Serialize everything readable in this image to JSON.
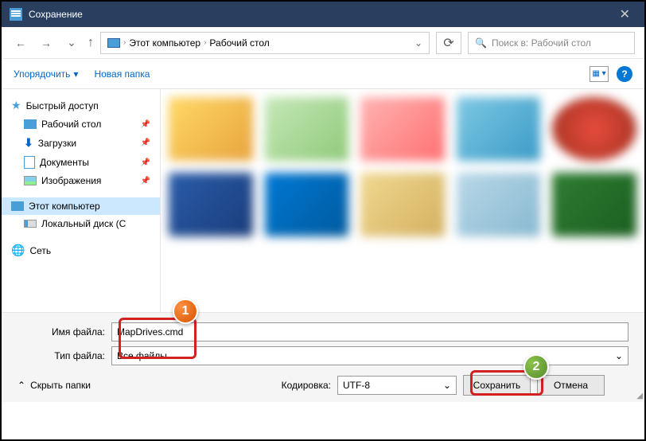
{
  "titlebar": {
    "title": "Сохранение"
  },
  "address": {
    "segments": [
      "Этот компьютер",
      "Рабочий стол"
    ]
  },
  "search": {
    "placeholder": "Поиск в: Рабочий стол"
  },
  "toolbar": {
    "organize": "Упорядочить",
    "new_folder": "Новая папка"
  },
  "sidebar": {
    "quick_access": "Быстрый доступ",
    "desktop": "Рабочий стол",
    "downloads": "Загрузки",
    "documents": "Документы",
    "pictures": "Изображения",
    "this_pc": "Этот компьютер",
    "local_disk": "Локальный диск (С",
    "network": "Сеть"
  },
  "form": {
    "filename_label": "Имя файла:",
    "filename_value": "MapDrives.cmd",
    "filetype_label": "Тип файла:",
    "filetype_value": "Все файлы"
  },
  "footer": {
    "hide_folders": "Скрыть папки",
    "encoding_label": "Кодировка:",
    "encoding_value": "UTF-8",
    "save": "Сохранить",
    "cancel": "Отмена"
  },
  "callouts": {
    "one": "1",
    "two": "2"
  }
}
